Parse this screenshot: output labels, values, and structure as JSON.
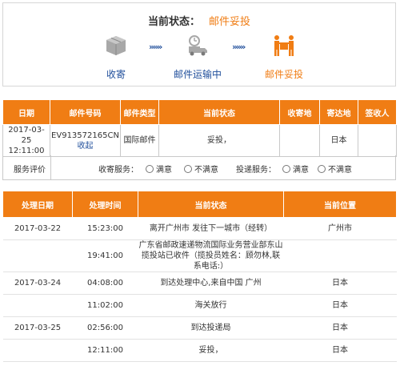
{
  "status": {
    "label": "当前状态：",
    "value": "邮件妥投",
    "steps": [
      {
        "label": "收寄",
        "icon": "package-icon"
      },
      {
        "label": "邮件运输中",
        "icon": "delivery-truck-icon"
      },
      {
        "label": "邮件妥投",
        "icon": "hand-over-package-icon"
      }
    ],
    "arrows": "»»»"
  },
  "info_table": {
    "headers": [
      "日期",
      "邮件号码",
      "邮件类型",
      "当前状态",
      "收寄地",
      "寄达地",
      "签收人"
    ],
    "row": {
      "date": "2017-03-25 12:11:00",
      "tracking_number": "EV913572165CN",
      "collect_link": "收起",
      "mail_type": "国际邮件",
      "status": "妥投，",
      "origin": "",
      "destination": "日本",
      "signer": ""
    }
  },
  "rating": {
    "label": "服务评价",
    "collect_service": "收寄服务：",
    "delivery_service": "投递服务：",
    "satisfied": "满意",
    "unsatisfied": "不满意"
  },
  "track_table": {
    "headers": [
      "处理日期",
      "处理时间",
      "当前状态",
      "当前位置"
    ],
    "rows": [
      {
        "date": "2017-03-22",
        "time": "15:23:00",
        "status": "离开广州市 发往下一城市（经转）",
        "location": "广州市"
      },
      {
        "date": "",
        "time": "19:41:00",
        "status": "广东省邮政速递物流国际业务营业部东山揽投站已收件（揽投员姓名：顾勿林,联系电话:）",
        "location": ""
      },
      {
        "date": "2017-03-24",
        "time": "04:08:00",
        "status": "到达处理中心,来自中国 广州",
        "location": "日本"
      },
      {
        "date": "",
        "time": "11:02:00",
        "status": "海关放行",
        "location": "日本"
      },
      {
        "date": "2017-03-25",
        "time": "02:56:00",
        "status": "到达投递局",
        "location": "日本"
      },
      {
        "date": "",
        "time": "12:11:00",
        "status": "妥投，",
        "location": "日本"
      }
    ]
  },
  "colors": {
    "accent": "#f07d14",
    "arrow": "#1f4e9b",
    "icon_gray": "#9a9a9a"
  }
}
